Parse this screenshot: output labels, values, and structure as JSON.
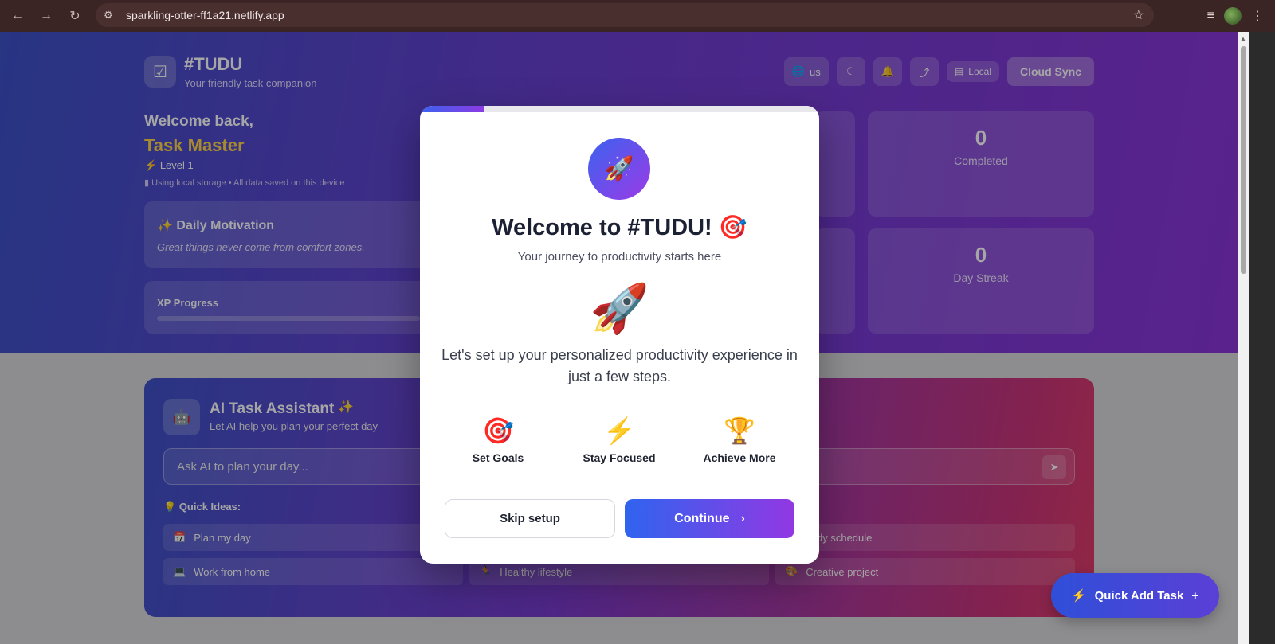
{
  "browser": {
    "url": "sparkling-otter-ff1a21.netlify.app",
    "back_icon": "←",
    "forward_icon": "→",
    "reload_icon": "↻",
    "site_info_icon": "⚙",
    "star_icon": "☆",
    "media_icon": "≡",
    "menu_icon": "⋮"
  },
  "app": {
    "brand": "#TUDU",
    "tagline": "Your friendly task companion",
    "logo_icon": "☑",
    "language": "us",
    "globe_icon": "🌐",
    "moon_icon": "☾",
    "bell_icon": "🔔",
    "share_icon": "⤴",
    "local_label": "Local",
    "local_icon": "▤",
    "cloud_sync_label": "Cloud Sync"
  },
  "profile": {
    "welcome": "Welcome back,",
    "name": "Task Master",
    "level_icon": "⚡",
    "level": "Level 1",
    "storage_note": "Using local storage • All data saved on this device",
    "storage_icon": "▮"
  },
  "motivation": {
    "icon": "✨",
    "title": "Daily Motivation",
    "quote": "Great things never come from comfort zones."
  },
  "xp": {
    "title": "XP Progress",
    "progress": 0
  },
  "stats": [
    {
      "value": "0",
      "label": "Completed"
    },
    {
      "value": "0",
      "label": "Day Streak"
    }
  ],
  "ai": {
    "icon": "🤖",
    "sparkle_icon": "✨",
    "title": "AI Task Assistant",
    "subtitle": "Let AI help you plan your perfect day",
    "input_placeholder": "Ask AI to plan your day...",
    "send_icon": "➤",
    "ideas_icon": "💡",
    "ideas_label": "Quick Ideas:",
    "ideas": [
      {
        "icon": "📅",
        "label": "Plan my day"
      },
      {
        "icon": "",
        "label": "dy schedule"
      },
      {
        "icon": "💻",
        "label": "Work from home"
      },
      {
        "icon": "🏃",
        "label": "Healthy lifestyle"
      },
      {
        "icon": "🎨",
        "label": "Creative project"
      }
    ]
  },
  "fab": {
    "icon": "⚡",
    "label": "Quick Add Task",
    "plus_icon": "+"
  },
  "modal": {
    "progress": 0.16,
    "badge_icon": "🚀",
    "title": "Welcome to #TUDU! 🎯",
    "subtitle": "Your journey to productivity starts here",
    "hero_icon": "🚀",
    "description": "Let's set up your personalized productivity experience in just a few steps.",
    "features": [
      {
        "icon": "🎯",
        "label": "Set Goals"
      },
      {
        "icon": "⚡",
        "label": "Stay Focused"
      },
      {
        "icon": "🏆",
        "label": "Achieve More"
      }
    ],
    "skip_label": "Skip setup",
    "continue_label": "Continue",
    "continue_icon": "›"
  },
  "colors": {
    "hero_start": "#3d52c9",
    "hero_end": "#8a35d8",
    "accent_gold": "#ffd54a",
    "button_start": "#2f64ef",
    "button_end": "#9238e3"
  }
}
